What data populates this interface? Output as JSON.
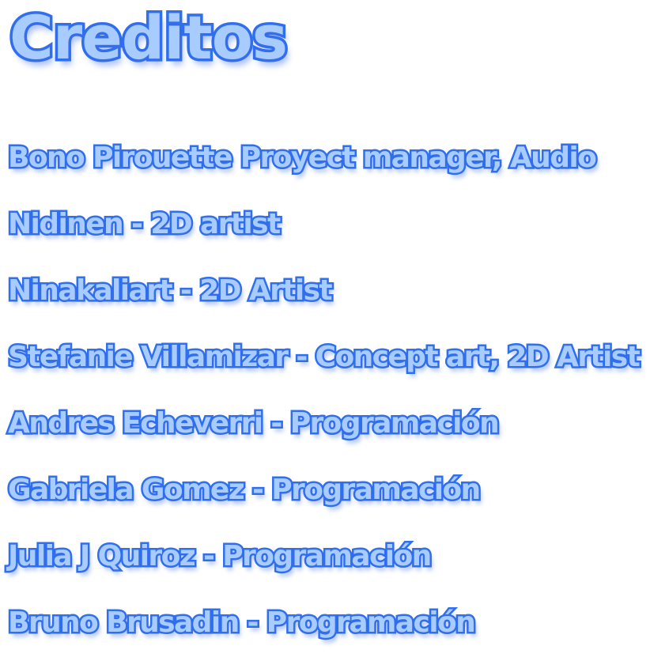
{
  "screen": {
    "title": "Creditos"
  },
  "credits": [
    "Bono Pirouette Proyect manager, Audio",
    "Nidinen - 2D artist",
    "Ninakaliart - 2D Artist",
    "Stefanie Villamizar - Concept art, 2D Artist",
    "Andres Echeverri - Programación",
    "Gabriela Gomez - Programación",
    "Julia J Quiroz - Programación",
    "Bruno Brusadin - Programación"
  ],
  "colors": {
    "text_fill": "#a9ccff",
    "text_outline": "#2f6ff0",
    "background": "#ffffff"
  }
}
